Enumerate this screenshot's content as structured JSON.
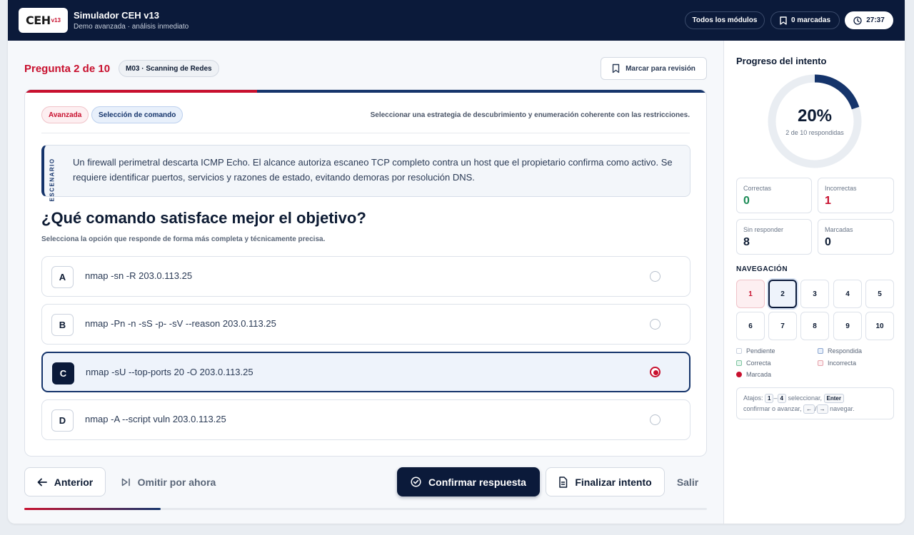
{
  "header": {
    "logo_text": "CEH",
    "logo_sub": "v13",
    "title": "Simulador CEH v13",
    "subtitle": "Demo avanzada · análisis inmediato",
    "modules_label": "Todos los módulos",
    "marked_label": "0 marcadas",
    "timer": "27:37"
  },
  "question_header": {
    "counter": "Pregunta 2 de 10",
    "module": "M03 · Scanning de Redes",
    "mark_label": "Marcar para revisión"
  },
  "card": {
    "progress": 0.34,
    "level_tag": "Avanzada",
    "type_tag": "Selección de comando",
    "objective": "Seleccionar una estrategia de descubrimiento y enumeración coherente con las restricciones.",
    "scenario_label": "ESCENARIO",
    "scenario_text": "Un firewall perimetral descarta ICMP Echo. El alcance autoriza escaneo TCP completo contra un host que el propietario confirma como activo. Se requiere identificar puertos, servicios y razones de estado, evitando demoras por resolución DNS.",
    "question": "¿Qué comando satisface mejor el objetivo?",
    "hint": "Selecciona la opción que responde de forma más completa y técnicamente precisa.",
    "options": [
      {
        "letter": "A",
        "text": "nmap -sn -R 203.0.113.25"
      },
      {
        "letter": "B",
        "text": "nmap -Pn -n -sS -p- -sV --reason 203.0.113.25"
      },
      {
        "letter": "C",
        "text": "nmap -sU --top-ports 20 -O 203.0.113.25"
      },
      {
        "letter": "D",
        "text": "nmap -A --script vuln 203.0.113.25"
      }
    ],
    "selected": "C"
  },
  "actions": {
    "prev": "Anterior",
    "skip": "Omitir por ahora",
    "confirm": "Confirmar respuesta",
    "finish": "Finalizar intento",
    "exit": "Salir"
  },
  "bottom_progress": 0.2,
  "sidebar": {
    "title": "Progreso del intento",
    "percent": "20%",
    "percent_value": 0.2,
    "answered": "2 de 10 respondidas",
    "stats": {
      "correct_label": "Correctas",
      "correct": "0",
      "incorrect_label": "Incorrectas",
      "incorrect": "1",
      "unanswered_label": "Sin responder",
      "unanswered": "8",
      "marked_label": "Marcadas",
      "marked": "0"
    },
    "nav_title": "NAVEGACIÓN",
    "questions": [
      "1",
      "2",
      "3",
      "4",
      "5",
      "6",
      "7",
      "8",
      "9",
      "10"
    ],
    "legend": {
      "pending": "Pendiente",
      "answered": "Respondida",
      "correct": "Correcta",
      "incorrect": "Incorrecta",
      "marked": "Marcada"
    },
    "shortcuts": {
      "prefix": "Atajos:",
      "k1": "1",
      "k4": "4",
      "select": "seleccionar,",
      "enter": "Enter",
      "confirm": "confirmar o avanzar,",
      "left": "←",
      "sep": "/",
      "right": "→",
      "navigate": "navegar."
    }
  },
  "colors": {
    "navy": "#0b1a3a",
    "brand_red": "#c8102e",
    "accent_blue": "#15346b"
  }
}
